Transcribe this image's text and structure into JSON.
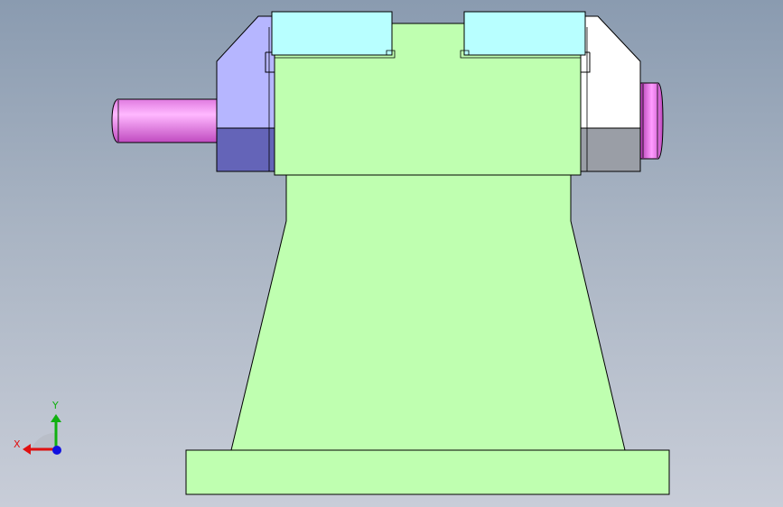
{
  "viewport": {
    "background_top": "#8a9bb0",
    "background_bottom": "#c8cdd8"
  },
  "parts": {
    "body_color": "#bfffb0",
    "clamp_top_color": "#b8ffff",
    "left_jaw_color": "#b6b6ff",
    "left_jaw_dark_color": "#6464b8",
    "right_jaw_color": "#ffffff",
    "right_jaw_dark_color": "#9a9ea6",
    "screw_color": "#f08cf0",
    "outline_color": "#000000"
  },
  "triad": {
    "x_label": "X",
    "y_label": "Y",
    "x_color": "#e01010",
    "y_color": "#10b010",
    "z_color": "#1010e0"
  }
}
